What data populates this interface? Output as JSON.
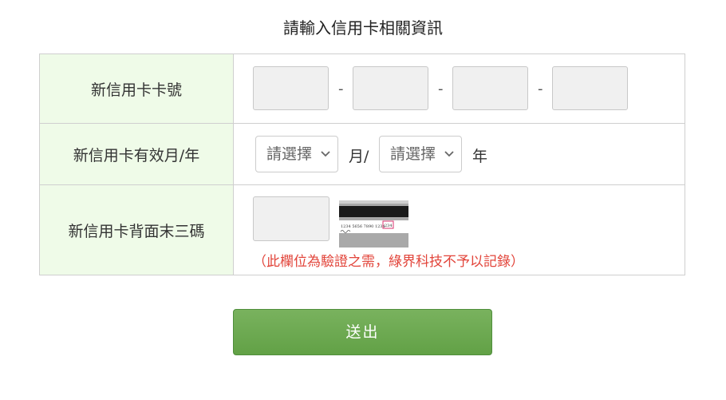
{
  "page": {
    "title": "請輸入信用卡相關資訊"
  },
  "rows": {
    "card_number": {
      "label": "新信用卡卡號",
      "separator": "-",
      "groups": [
        "",
        "",
        "",
        ""
      ]
    },
    "expiry": {
      "label": "新信用卡有效月/年",
      "month_select": "請選擇",
      "month_unit": "月/",
      "year_select": "請選擇",
      "year_unit": "年"
    },
    "cvv": {
      "label": "新信用卡背面末三碼",
      "value": "",
      "card_image": {
        "number_text": "1234 5656 7890 1234",
        "cvv_text": "234"
      },
      "note": "（此欄位為驗證之需，綠界科技不予以記錄）"
    }
  },
  "submit": {
    "label": "送出"
  },
  "colors": {
    "label_bg": "#effbe8",
    "note": "#e2443a",
    "button": "#6aa84f"
  },
  "icons": {
    "select_arrow": "chevron-down-icon"
  }
}
